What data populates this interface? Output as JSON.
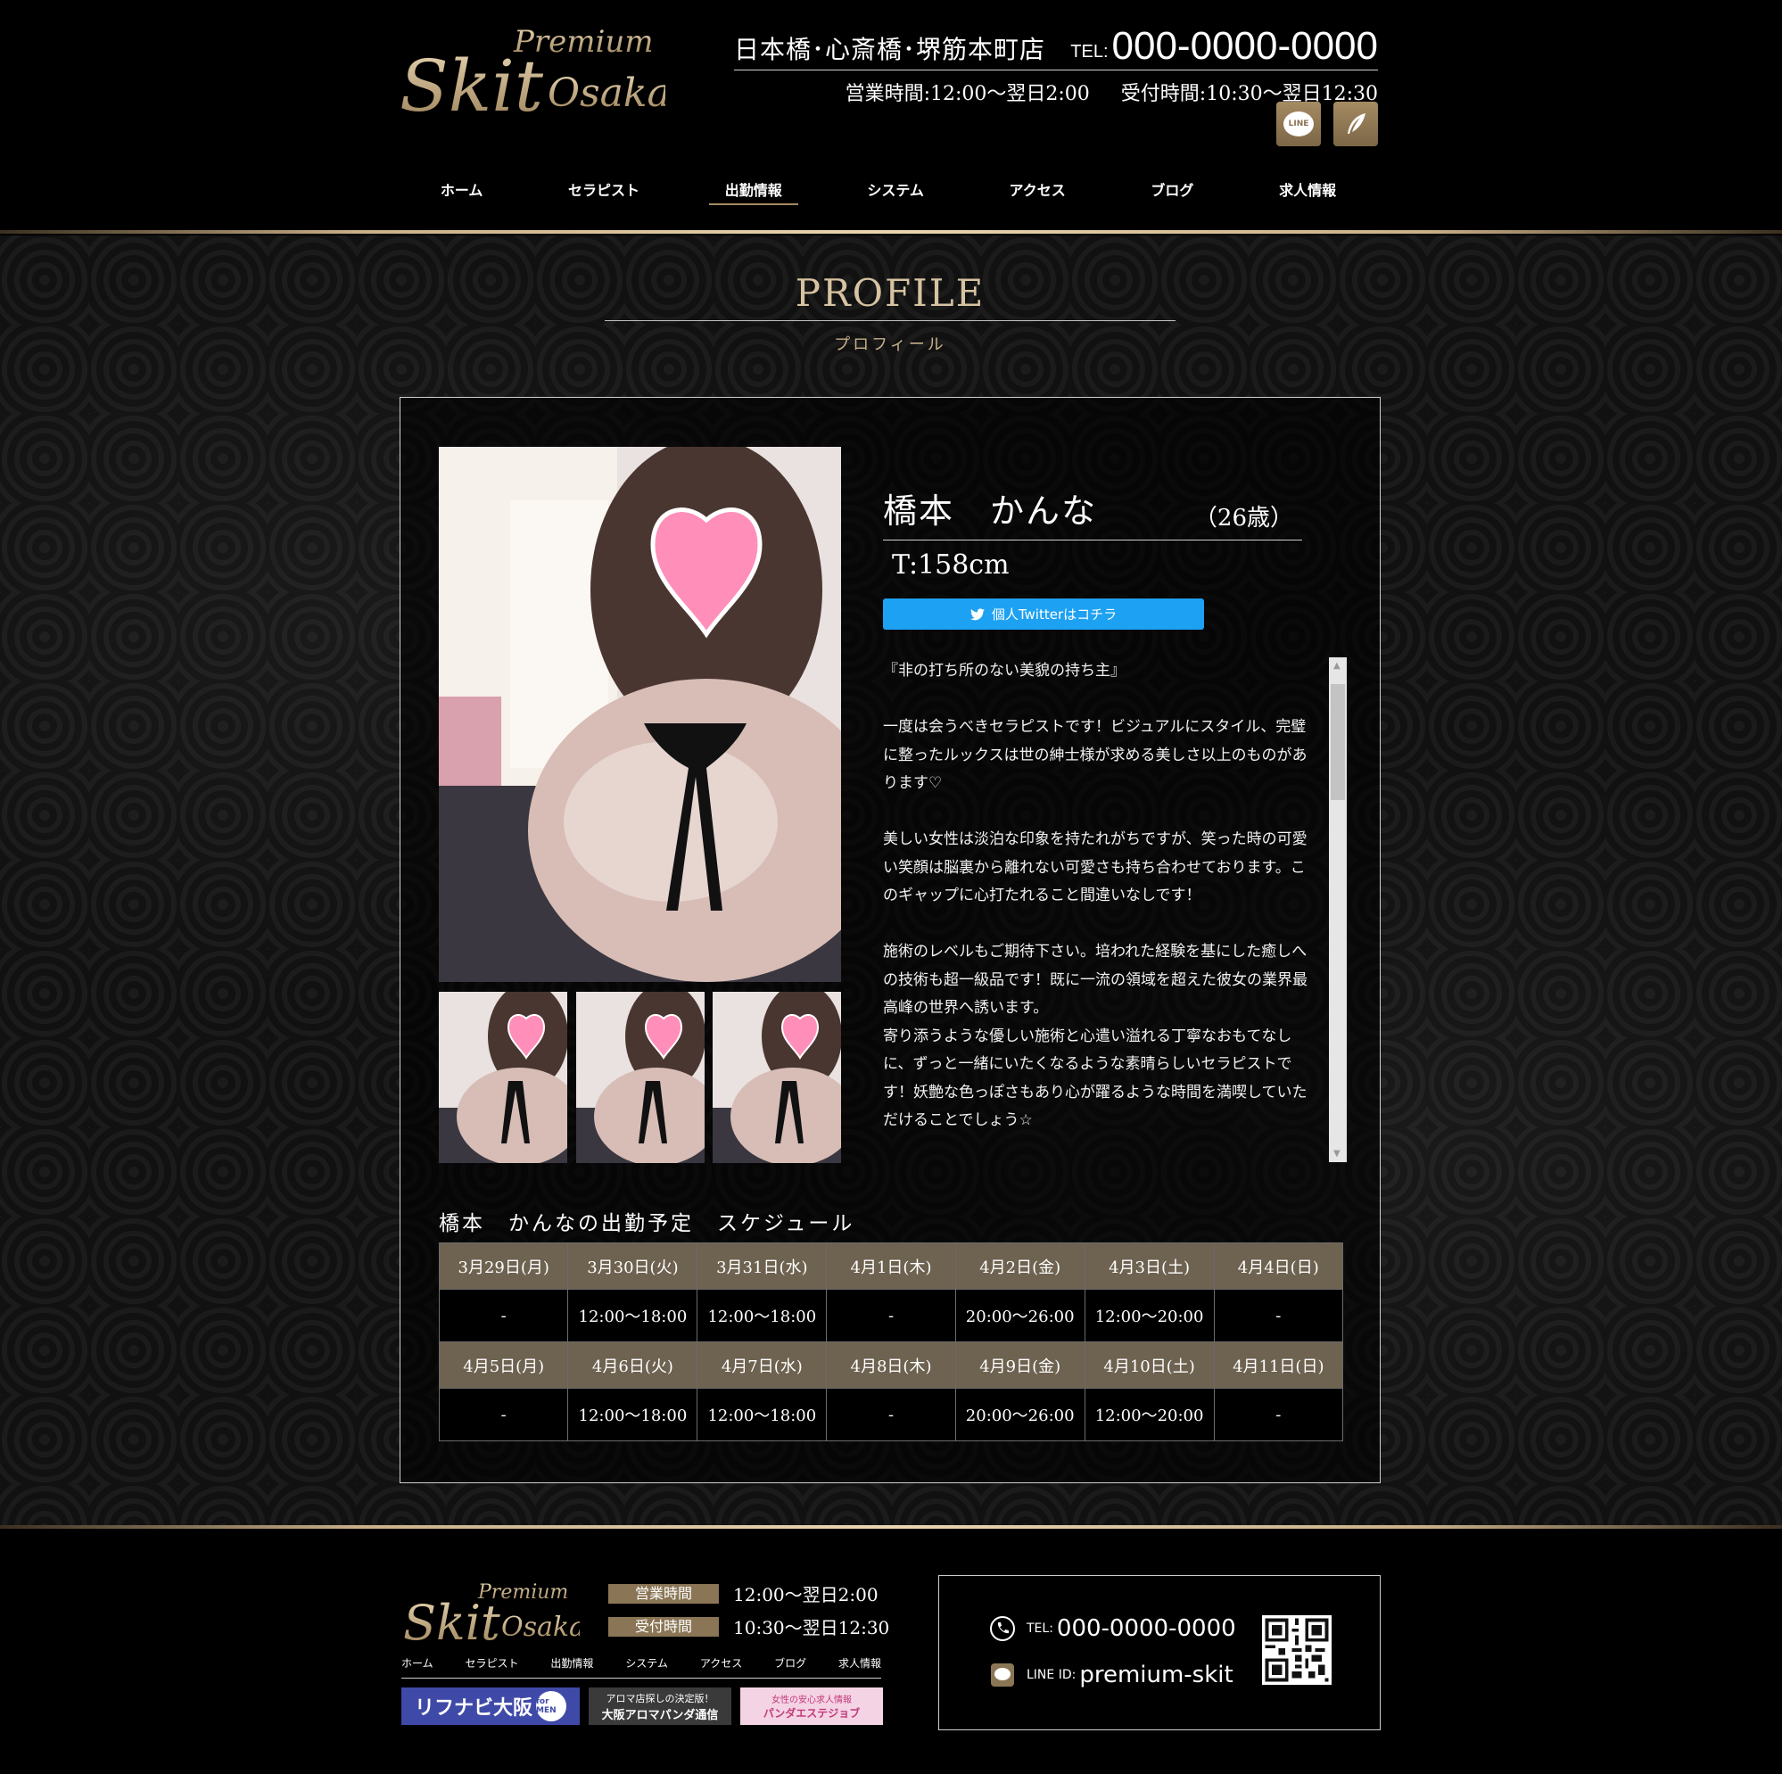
{
  "header": {
    "logo_top": "Premium",
    "logo_main": "Skit",
    "logo_sub": "Osaka",
    "store_name": "日本橋･心斎橋･堺筋本町店",
    "tel_label": "TEL:",
    "tel": "000-0000-0000",
    "business_hours": "営業時間:12:00～翌日2:00",
    "reception_hours": "受付時間:10:30～翌日12:30",
    "sns": [
      "LINE",
      "feather"
    ]
  },
  "nav": [
    {
      "label": "ホーム"
    },
    {
      "label": "セラピスト"
    },
    {
      "label": "出勤情報",
      "active": true
    },
    {
      "label": "システム"
    },
    {
      "label": "アクセス"
    },
    {
      "label": "ブログ"
    },
    {
      "label": "求人情報"
    }
  ],
  "section": {
    "title_en": "PROFILE",
    "title_jp": "プロフィール"
  },
  "profile": {
    "name": "橋本　かんな",
    "age": "（26歳）",
    "height": "T:158cm",
    "twitter_button": "個人Twitterはコチラ",
    "description": "『非の打ち所のない美貌の持ち主』\n\n一度は会うべきセラピストです！ビジュアルにスタイル、完璧に整ったルックスは世の紳士様が求める美しさ以上のものがあります♡\n\n美しい女性は淡泊な印象を持たれがちですが、笑った時の可愛い笑顔は脳裏から離れない可愛さも持ち合わせております。このギャップに心打たれること間違いなしです！\n\n施術のレベルもご期待下さい。培われた経験を基にした癒しへの技術も超一級品です！既に一流の領域を超えた彼女の業界最高峰の世界へ誘います。\n寄り添うような優しい施術と心遣い溢れる丁寧なおもてなしに、ずっと一緒にいたくなるような素晴らしいセラピストです！妖艶な色っぽさもあり心が躍るような時間を満喫していただけることでしょう☆"
  },
  "schedule": {
    "title": "橋本　かんなの出勤予定　スケジュール",
    "weeks": [
      {
        "dates": [
          "3月29日(月)",
          "3月30日(火)",
          "3月31日(水)",
          "4月1日(木)",
          "4月2日(金)",
          "4月3日(土)",
          "4月4日(日)"
        ],
        "times": [
          "-",
          "12:00～18:00",
          "12:00～18:00",
          "-",
          "20:00～26:00",
          "12:00～20:00",
          "-"
        ]
      },
      {
        "dates": [
          "4月5日(月)",
          "4月6日(火)",
          "4月7日(水)",
          "4月8日(木)",
          "4月9日(金)",
          "4月10日(土)",
          "4月11日(日)"
        ],
        "times": [
          "-",
          "12:00～18:00",
          "12:00～18:00",
          "-",
          "20:00～26:00",
          "12:00～20:00",
          "-"
        ]
      }
    ]
  },
  "footer": {
    "hours_label": "営業時間",
    "hours": "12:00～翌日2:00",
    "reception_label": "受付時間",
    "reception": "10:30～翌日12:30",
    "nav": [
      "ホーム",
      "セラピスト",
      "出勤情報",
      "システム",
      "アクセス",
      "ブログ",
      "求人情報"
    ],
    "banners": {
      "b1": "リフナビ大阪",
      "b1_badge": "for MEN",
      "b2_line1": "アロマ店探しの決定版！",
      "b2_line2": "大阪アロマパンダ通信",
      "b3_line1": "女性の安心求人情報",
      "b3_line2": "パンダエステジョブ"
    },
    "tel_label": "TEL:",
    "tel": "000-0000-0000",
    "line_label": "LINE ID:",
    "line_id": "premium-skit"
  },
  "colors": {
    "gold": "#a58b63",
    "twitter": "#1da1f2",
    "schedule_header": "#6e6250"
  }
}
